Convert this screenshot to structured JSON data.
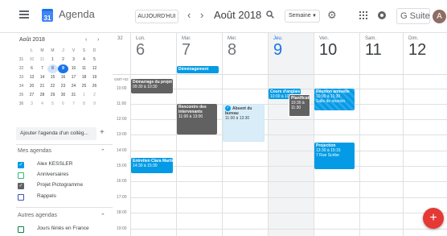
{
  "header": {
    "app_title": "Agenda",
    "logo_text": "31",
    "today_button": "AUJOURD'HUI",
    "prev": "‹",
    "next": "›",
    "period": "Août 2018",
    "view_select": "Semaine",
    "gsuite": "G Suite",
    "avatar": "A"
  },
  "mini_calendar": {
    "title": "Août 2018",
    "prev": "‹",
    "next": "›",
    "weekday_headers": [
      "L",
      "M",
      "M",
      "J",
      "V",
      "S",
      "D"
    ],
    "rows": [
      {
        "week": "31",
        "days": [
          "30",
          "31",
          "1",
          "2",
          "3",
          "4",
          "5"
        ]
      },
      {
        "week": "32",
        "days": [
          "6",
          "7",
          "8",
          "9",
          "10",
          "11",
          "12"
        ]
      },
      {
        "week": "33",
        "days": [
          "13",
          "14",
          "15",
          "16",
          "17",
          "18",
          "19"
        ]
      },
      {
        "week": "34",
        "days": [
          "20",
          "21",
          "22",
          "23",
          "24",
          "25",
          "26"
        ]
      },
      {
        "week": "35",
        "days": [
          "27",
          "28",
          "29",
          "30",
          "31",
          "1",
          "2"
        ]
      },
      {
        "week": "36",
        "days": [
          "3",
          "4",
          "5",
          "6",
          "7",
          "8",
          "9"
        ]
      }
    ]
  },
  "sidebar": {
    "add_calendar_placeholder": "Ajouter l'agenda d'un collèg...",
    "add_plus": "+",
    "my_calendars_title": "Mes agendas",
    "my_calendars": [
      {
        "label": "Alex KESSLER",
        "color": "#039be5",
        "checked": true
      },
      {
        "label": "Anniversaires",
        "color": "#33b679",
        "checked": false
      },
      {
        "label": "Projet Pictogramme",
        "color": "#616161",
        "checked": true
      },
      {
        "label": "Rappels",
        "color": "#3f51b5",
        "checked": false
      }
    ],
    "other_calendars_title": "Autres agendas",
    "other_calendars": [
      {
        "label": "Jours fériés en France",
        "color": "#0b8043",
        "checked": false
      }
    ]
  },
  "week": {
    "week_number": "32",
    "timezone": "GMT+02",
    "days": [
      {
        "name": "Lun.",
        "num": "6"
      },
      {
        "name": "Mar.",
        "num": "7"
      },
      {
        "name": "Mer.",
        "num": "8"
      },
      {
        "name": "Jeu.",
        "num": "9"
      },
      {
        "name": "Ven.",
        "num": "10"
      },
      {
        "name": "Sam.",
        "num": "11"
      },
      {
        "name": "Dim.",
        "num": "12"
      }
    ],
    "times": [
      "10:00",
      "11:00",
      "12:00",
      "13:00",
      "14:00",
      "15:00",
      "16:00",
      "17:00",
      "18:00",
      "19:00"
    ]
  },
  "events": {
    "demenagement": {
      "title": "Déménagement"
    },
    "demarrage": {
      "title": "Démarrage du projet",
      "time": "09:30 à 10:30"
    },
    "rencontre": {
      "title": "Rencontre des intervenants",
      "time": "11:00 à 13:00"
    },
    "absent": {
      "title": "Absent du bureau",
      "time": "11:00 à 13:30",
      "icon": "✓"
    },
    "cours": {
      "title": "Cours d'anglais",
      "time": "10:00 à 10:30"
    },
    "planif": {
      "title": "Planification",
      "time": "10:30 à 11:30"
    },
    "reunion": {
      "title": "Réunion annuelle",
      "time": "10:00 à 11:30",
      "place": "Salle de réunion"
    },
    "projection": {
      "title": "Projection",
      "time": "13:30 à 15:15",
      "place": "7 Rue Scribe"
    },
    "entretien": {
      "title": "Entretien Clara Martin",
      "time": "14:30 à 15:30"
    }
  },
  "fab": "+",
  "colors": {
    "accent": "#1a73e8",
    "event_blue": "#039be5",
    "event_dark": "#616161",
    "fab_red": "#e53935"
  }
}
